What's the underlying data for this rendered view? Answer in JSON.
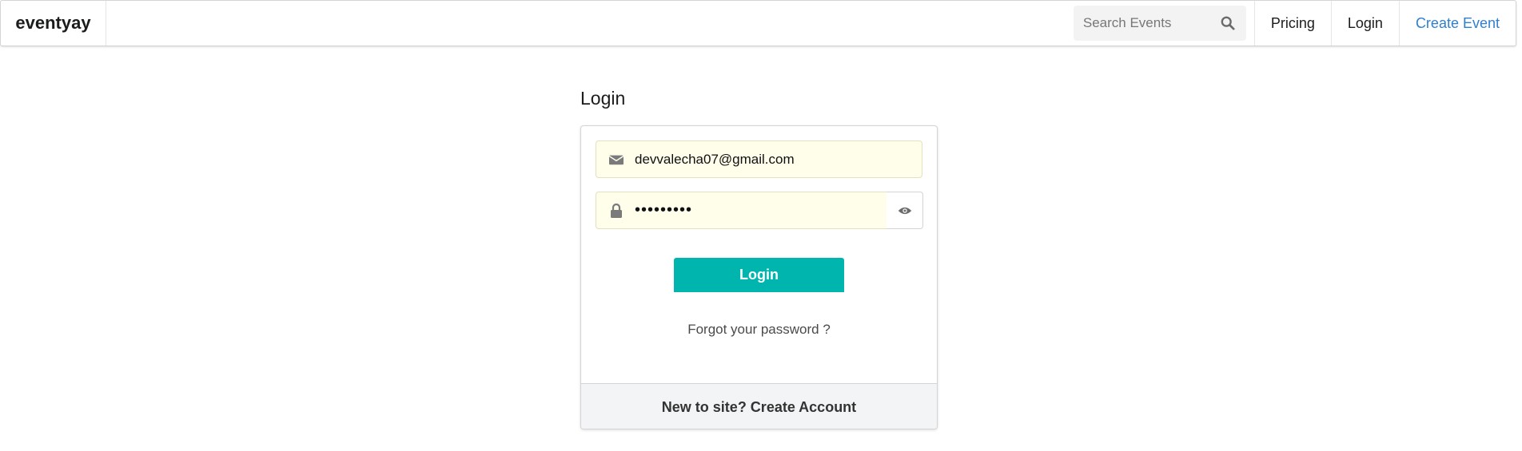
{
  "navbar": {
    "brand": "eventyay",
    "search": {
      "placeholder": "Search Events",
      "icon": "search-icon"
    },
    "items": [
      {
        "label": "Pricing"
      },
      {
        "label": "Login"
      },
      {
        "label": "Create Event",
        "color": "#2f7fd1"
      }
    ]
  },
  "login": {
    "title": "Login",
    "email": {
      "value": "devvalecha07@gmail.com",
      "icon": "envelope-icon"
    },
    "password": {
      "value": "devvalech",
      "icon": "lock-icon",
      "toggle_icon": "eye-icon"
    },
    "submit_label": "Login",
    "forgot_label": "Forgot your password ?",
    "footer_label": "New to site? Create Account"
  },
  "colors": {
    "accent": "#00b5ad",
    "link": "#2f7fd1",
    "autofill_bg": "#fefeea"
  }
}
